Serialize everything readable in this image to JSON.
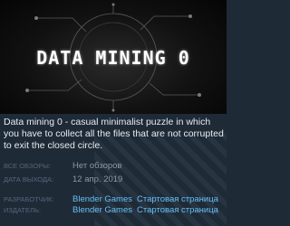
{
  "game": {
    "logo_text": "DATA MINING 0",
    "description": "Data mining 0 - casual minimalist puzzle in which you have to collect all the files that are not corrupted to exit the closed circle."
  },
  "info": {
    "reviews_label": "ВСЕ ОБЗОРЫ:",
    "reviews_value": "Нет обзоров",
    "release_label": "ДАТА ВЫХОДА:",
    "release_value": "12 апр. 2019",
    "developer_label": "РАЗРАБОТЧИК:",
    "developer_name": "Blender Games",
    "developer_page": "Стартовая страница",
    "publisher_label": "ИЗДАТЕЛЬ:",
    "publisher_name": "Blender Games",
    "publisher_page": "Стартовая страница"
  },
  "colors": {
    "background": "#1f2a37",
    "link": "#66c0f4",
    "label": "#55657a",
    "value": "#8f98a0"
  }
}
